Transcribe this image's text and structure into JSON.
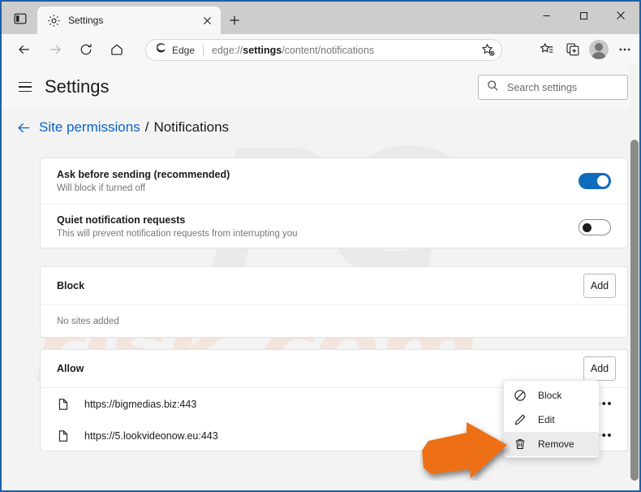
{
  "browser": {
    "tab_actions_icon": "vertical-tabs-icon",
    "tab": {
      "favicon": "gear-icon",
      "title": "Settings",
      "close_icon": "close-icon"
    },
    "new_tab_icon": "plus-icon",
    "window_controls": {
      "minimize": "minimize-icon",
      "maximize": "maximize-icon",
      "close": "close-icon"
    },
    "nav": {
      "back_icon": "arrow-left-icon",
      "forward_icon": "arrow-right-icon",
      "refresh_icon": "refresh-icon",
      "home_icon": "home-icon"
    },
    "omnibox": {
      "brand_icon": "edge-logo-icon",
      "brand_label": "Edge",
      "url_prefix": "edge://",
      "url_bold": "settings",
      "url_suffix": "/content/notifications",
      "favorite_icon": "star-add-icon"
    },
    "toolbar_right": {
      "collections_icon": "collections-icon",
      "browser_essentials_icon": "browser-essentials-icon",
      "profile_icon": "avatar-icon",
      "more_icon": "ellipsis-icon"
    }
  },
  "settings": {
    "menu_icon": "hamburger-icon",
    "title": "Settings",
    "search": {
      "icon": "search-icon",
      "placeholder": "Search settings",
      "value": ""
    },
    "breadcrumb": {
      "back_icon": "arrow-left-icon",
      "parent": "Site permissions",
      "separator": "/",
      "current": "Notifications"
    },
    "toggles": [
      {
        "title": "Ask before sending (recommended)",
        "subtitle": "Will block if turned off",
        "state": "on"
      },
      {
        "title": "Quiet notification requests",
        "subtitle": "This will prevent notification requests from interrupting you",
        "state": "off"
      }
    ],
    "block_section": {
      "title": "Block",
      "add_label": "Add",
      "empty_text": "No sites added"
    },
    "allow_section": {
      "title": "Allow",
      "add_label": "Add",
      "sites": [
        {
          "icon": "page-icon",
          "url": "https://bigmedias.biz:443",
          "more_icon": "ellipsis-icon",
          "more_label": "•••"
        },
        {
          "icon": "page-icon",
          "url": "https://5.lookvideonow.eu:443",
          "more_icon": "ellipsis-icon",
          "more_label": "•••"
        }
      ]
    }
  },
  "context_menu": {
    "items": [
      {
        "icon": "block-icon",
        "label": "Block",
        "hovered": false
      },
      {
        "icon": "pencil-icon",
        "label": "Edit",
        "hovered": false
      },
      {
        "icon": "trash-icon",
        "label": "Remove",
        "hovered": true
      }
    ]
  },
  "annotation": {
    "arrow_icon": "orange-arrow-right",
    "arrow_color": "#ee7019"
  },
  "watermark": {
    "primary": "PC",
    "secondary": "risk.com"
  },
  "colors": {
    "accent_blue": "#0f6cbd",
    "link_blue": "#0a63c9",
    "window_border": "#1f5fa8",
    "annotation_orange": "#ee7019"
  }
}
